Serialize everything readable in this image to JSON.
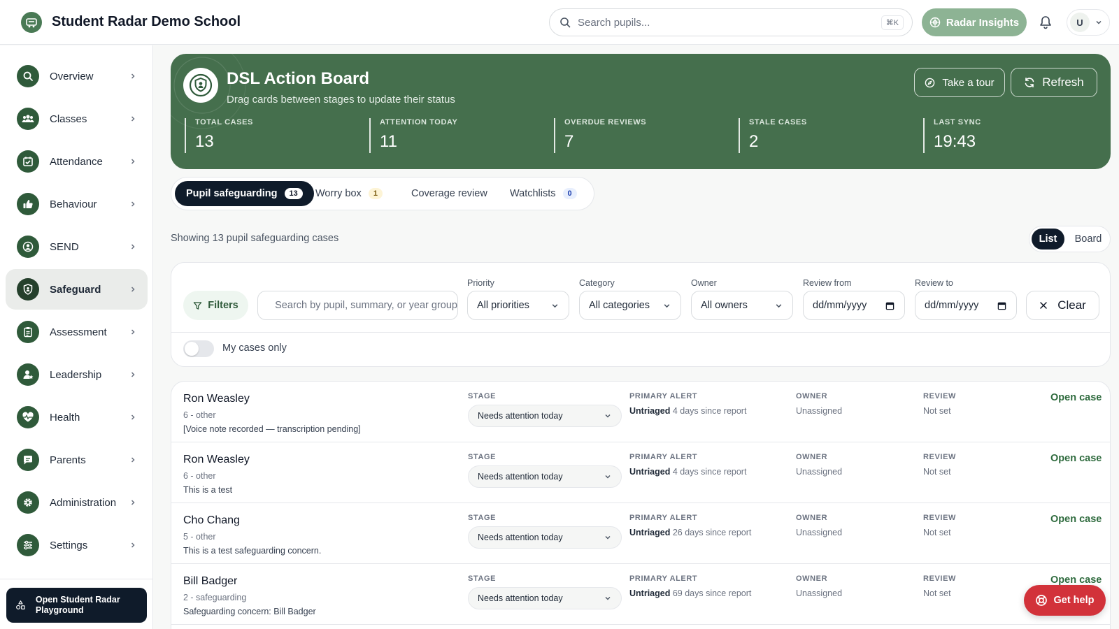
{
  "header": {
    "school_name": "Student Radar Demo School",
    "search_placeholder": "Search pupils...",
    "search_shortcut": "⌘K",
    "insights_label": "Radar Insights",
    "user_initial": "U"
  },
  "sidebar": {
    "items": [
      {
        "label": "Overview",
        "icon": "search-icon"
      },
      {
        "label": "Classes",
        "icon": "users-icon"
      },
      {
        "label": "Attendance",
        "icon": "calendar-check-icon"
      },
      {
        "label": "Behaviour",
        "icon": "thumbs-up-icon"
      },
      {
        "label": "SEND",
        "icon": "user-circle-icon"
      },
      {
        "label": "Safeguard",
        "icon": "shield-icon"
      },
      {
        "label": "Assessment",
        "icon": "clipboard-icon"
      },
      {
        "label": "Leadership",
        "icon": "user-star-icon"
      },
      {
        "label": "Health",
        "icon": "heart-pulse-icon"
      },
      {
        "label": "Parents",
        "icon": "message-icon"
      },
      {
        "label": "Administration",
        "icon": "gear-icon"
      },
      {
        "label": "Settings",
        "icon": "sliders-icon"
      }
    ],
    "active": "Safeguard",
    "playground_label": "Open Student Radar Playground"
  },
  "hero": {
    "title": "DSL Action Board",
    "subtitle": "Drag cards between stages to update their status",
    "tour_label": "Take a tour",
    "refresh_label": "Refresh",
    "stats": [
      {
        "label": "TOTAL CASES",
        "value": "13"
      },
      {
        "label": "ATTENTION TODAY",
        "value": "11"
      },
      {
        "label": "OVERDUE REVIEWS",
        "value": "7"
      },
      {
        "label": "STALE CASES",
        "value": "2"
      },
      {
        "label": "LAST SYNC",
        "value": "19:43"
      }
    ]
  },
  "tabs": [
    {
      "label": "Pupil safeguarding",
      "count": "13"
    },
    {
      "label": "Worry box",
      "count": "1"
    },
    {
      "label": "Coverage review",
      "count": ""
    },
    {
      "label": "Watchlists",
      "count": "0"
    }
  ],
  "showing_text": "Showing 13 pupil safeguarding cases",
  "view_toggle": {
    "list": "List",
    "board": "Board",
    "active": "List"
  },
  "filters": {
    "filters_label": "Filters",
    "search_placeholder": "Search by pupil, summary, or year group",
    "priority_label": "Priority",
    "priority_value": "All priorities",
    "category_label": "Category",
    "category_value": "All categories",
    "owner_label": "Owner",
    "owner_value": "All owners",
    "review_from_label": "Review from",
    "review_from_value": "dd/mm/yyyy",
    "review_to_label": "Review to",
    "review_to_value": "dd/mm/yyyy",
    "clear_label": "Clear",
    "my_cases_label": "My cases only",
    "my_cases_on": false
  },
  "columns": {
    "stage": "STAGE",
    "primary_alert": "PRIMARY ALERT",
    "owner": "OWNER",
    "review": "REVIEW",
    "open_case": "Open case"
  },
  "cases": [
    {
      "name": "Ron Weasley",
      "meta": "6 - other",
      "summary": "[Voice note recorded — transcription pending]",
      "stage": "Needs attention today",
      "alert_status": "Untriaged",
      "alert_detail": "4 days since report",
      "owner": "Unassigned",
      "review": "Not set"
    },
    {
      "name": "Ron Weasley",
      "meta": "6 - other",
      "summary": "This is a test",
      "stage": "Needs attention today",
      "alert_status": "Untriaged",
      "alert_detail": "4 days since report",
      "owner": "Unassigned",
      "review": "Not set"
    },
    {
      "name": "Cho Chang",
      "meta": "5 - other",
      "summary": "This is a test safeguarding concern.",
      "stage": "Needs attention today",
      "alert_status": "Untriaged",
      "alert_detail": "26 days since report",
      "owner": "Unassigned",
      "review": "Not set"
    },
    {
      "name": "Bill Badger",
      "meta": "2 - safeguarding",
      "summary": "Safeguarding concern: Bill Badger",
      "stage": "Needs attention today",
      "alert_status": "Untriaged",
      "alert_detail": "69 days since report",
      "owner": "Unassigned",
      "review": "Not set"
    }
  ],
  "help_label": "Get help"
}
